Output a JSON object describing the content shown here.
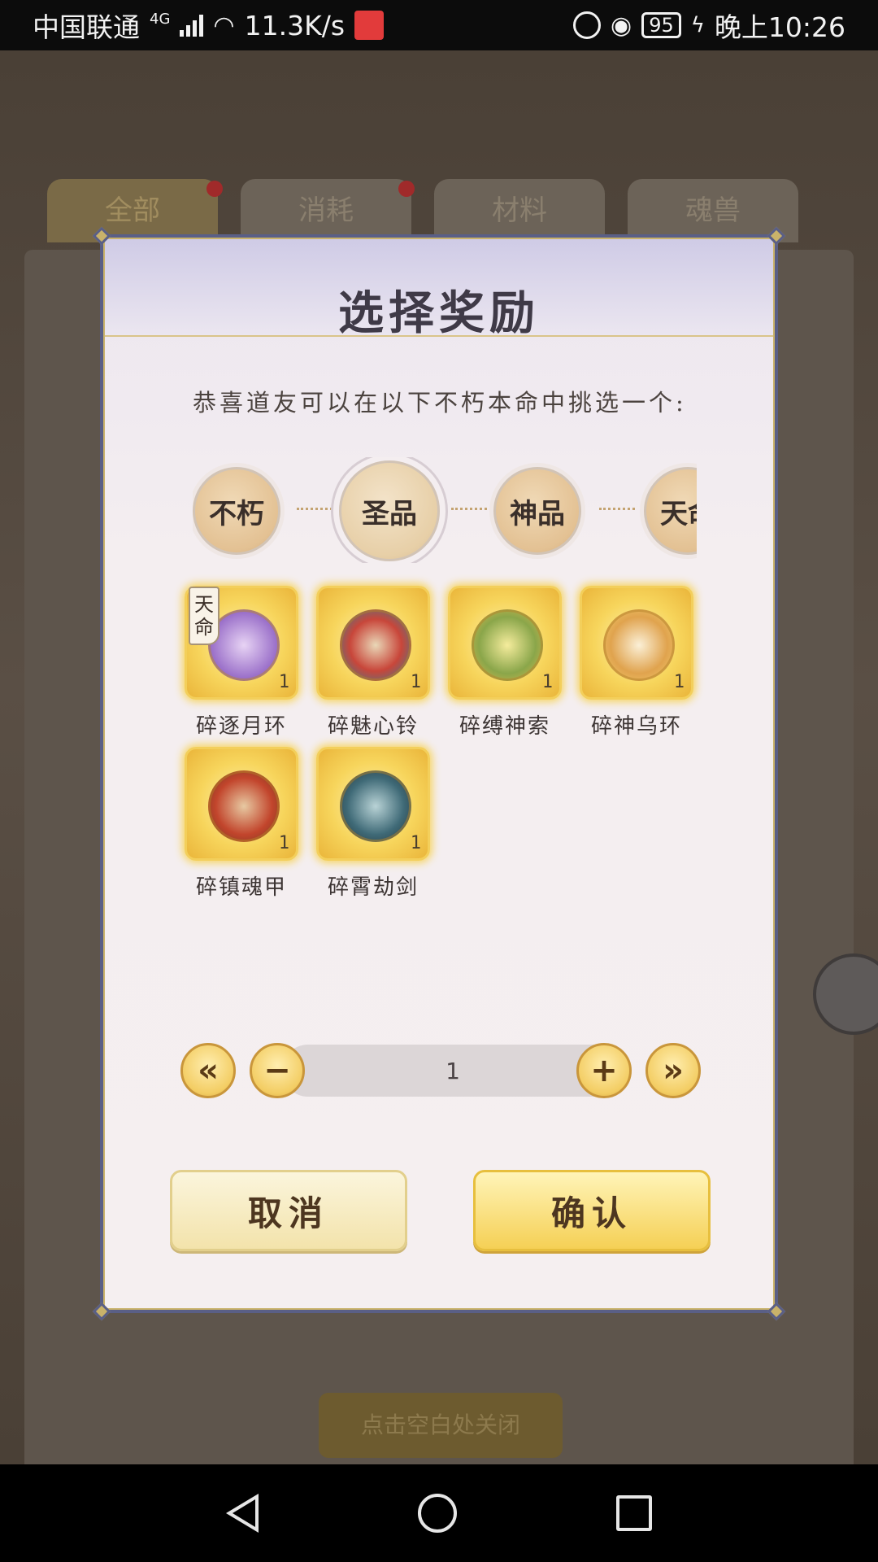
{
  "status_bar": {
    "carrier": "中国联通",
    "network_type": "4G",
    "speed": "11.3K/s",
    "battery": "95",
    "time": "晚上10:26"
  },
  "background": {
    "tabs": [
      "全部",
      "消耗",
      "材料",
      "魂兽"
    ],
    "hint": "点击空白处关闭"
  },
  "dialog": {
    "title": "选择奖励",
    "subtitle": "恭喜道友可以在以下不朽本命中挑选一个:",
    "tiers": [
      {
        "label": "不朽",
        "selected": false
      },
      {
        "label": "圣品",
        "selected": true
      },
      {
        "label": "神品",
        "selected": false
      },
      {
        "label": "天命",
        "selected": false
      }
    ],
    "items": [
      {
        "name": "碎逐月环",
        "count": "1",
        "badge": "天命",
        "gem_color": "#9a6fc9"
      },
      {
        "name": "碎魅心铃",
        "count": "1",
        "badge": "",
        "gem_color": "#c8463a"
      },
      {
        "name": "碎缚神索",
        "count": "1",
        "badge": "",
        "gem_color": "#8aa64a"
      },
      {
        "name": "碎神乌环",
        "count": "1",
        "badge": "",
        "gem_color": "#e0a34e"
      },
      {
        "name": "碎镇魂甲",
        "count": "1",
        "badge": "",
        "gem_color": "#c2452c"
      },
      {
        "name": "碎霄劫剑",
        "count": "1",
        "badge": "",
        "gem_color": "#3f6a77"
      }
    ],
    "quantity": {
      "value": "1",
      "min_label": "«",
      "decrement_label": "−",
      "increment_label": "+",
      "max_label": "»"
    },
    "cancel_label": "取消",
    "confirm_label": "确认"
  },
  "colors": {
    "gold": "#f5d055",
    "frame": "#5a5f86"
  }
}
